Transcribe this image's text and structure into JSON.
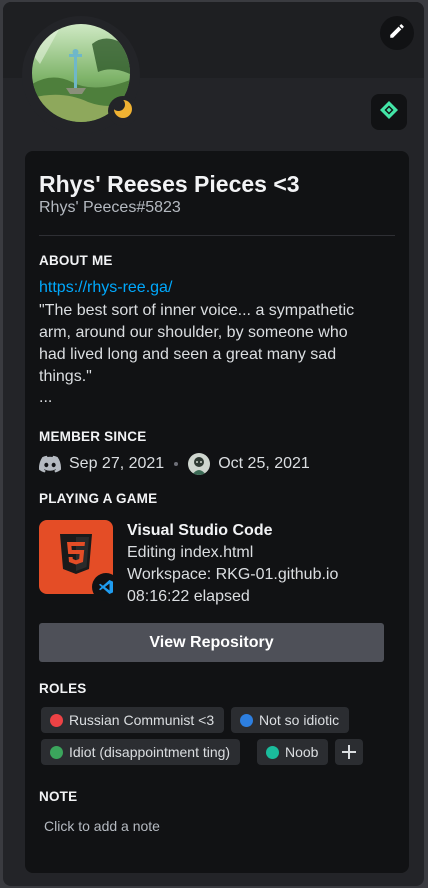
{
  "profile": {
    "display_name": "Rhys' Reeses Pieces <3",
    "username_tag": "Rhys' Peeces#5823",
    "status": "idle"
  },
  "about": {
    "heading": "ABOUT ME",
    "link": "https://rhys-ree.ga/",
    "quote_lines": [
      "\"The best sort of inner voice... a sympathetic",
      "arm, around our shoulder, by someone who",
      "had lived long and seen a great many sad",
      "things.\""
    ],
    "ellipsis": "..."
  },
  "member_since": {
    "heading": "MEMBER SINCE",
    "discord_date": "Sep 27, 2021",
    "server_date": "Oct 25, 2021"
  },
  "activity": {
    "heading": "PLAYING A GAME",
    "name": "Visual Studio Code",
    "details": "Editing index.html",
    "state": "Workspace: RKG-01.github.io",
    "elapsed": "08:16:22 elapsed",
    "button_label": "View Repository",
    "large_icon": "html5-icon",
    "small_icon": "vscode-icon"
  },
  "roles": {
    "heading": "ROLES",
    "items": [
      {
        "name": "Russian Communist <3",
        "color": "#ed4245"
      },
      {
        "name": "Not so idiotic",
        "color": "#2d7fe0"
      },
      {
        "name": "Idiot (disappointment ting)",
        "color": "#3ba55c"
      },
      {
        "name": "Noob",
        "color": "#1abc9c"
      }
    ],
    "add_label": "+"
  },
  "note": {
    "heading": "NOTE",
    "placeholder": "Click to add a note"
  },
  "colors": {
    "link": "#00a8fc",
    "idle": "#f0b232",
    "html5": "#e44d26",
    "vscode": "#1f9cf0",
    "nitro_badge": "#43e5a7"
  }
}
